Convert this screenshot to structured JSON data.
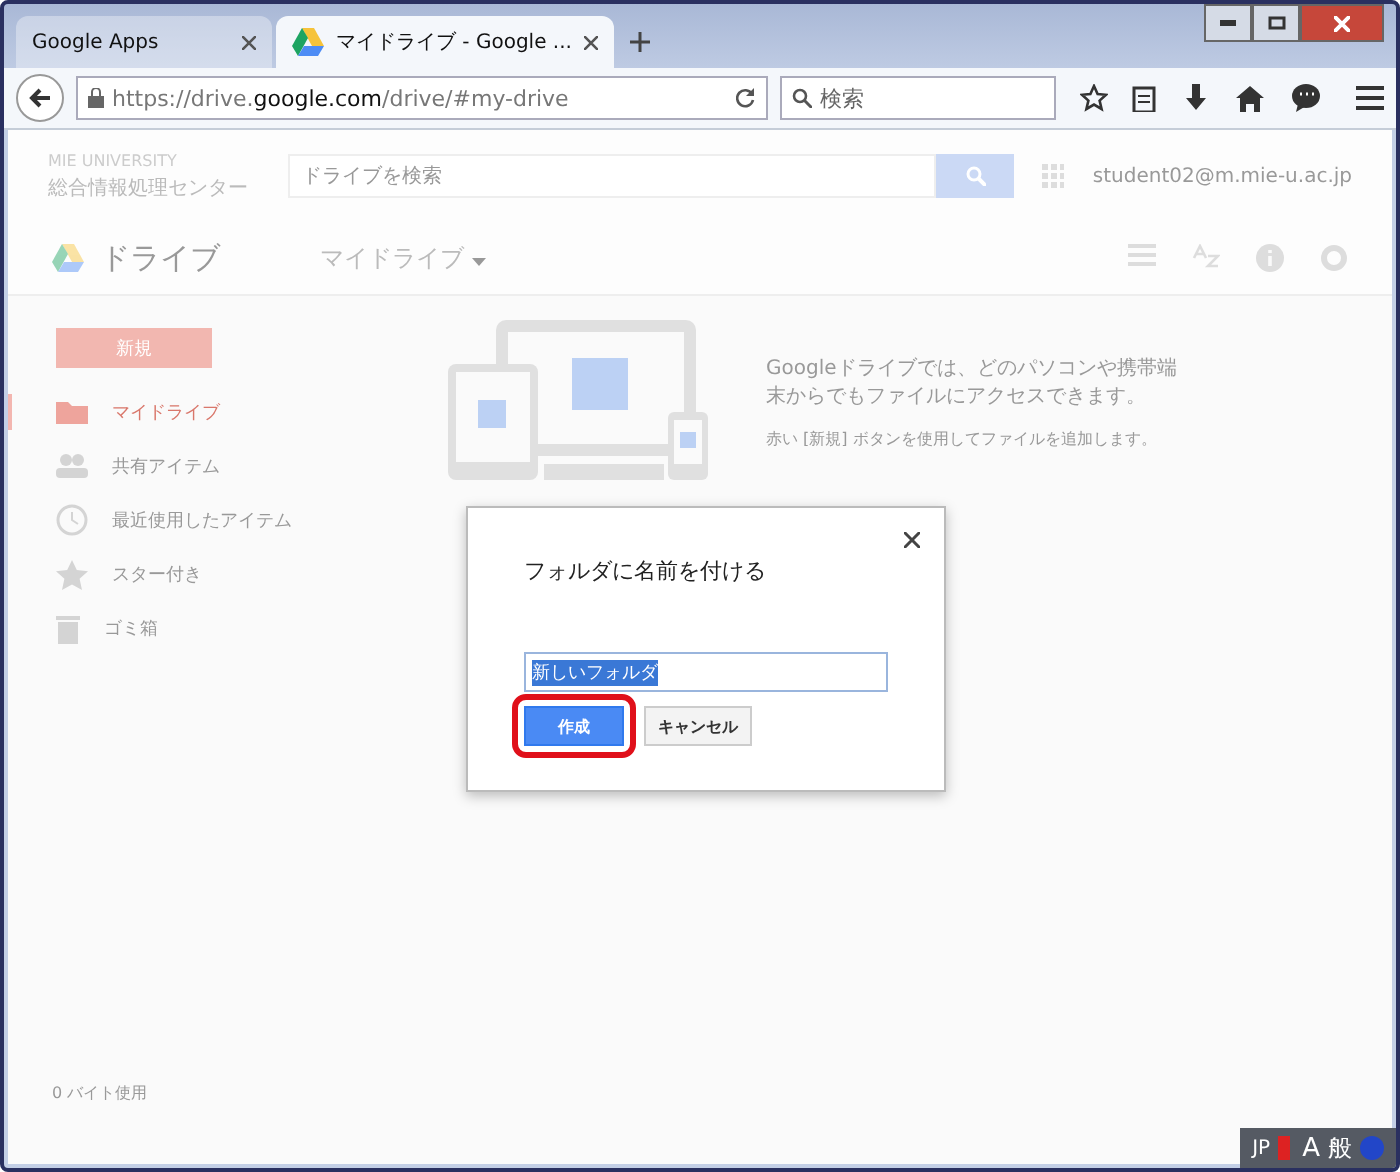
{
  "browser": {
    "tabs": [
      {
        "label": "Google Apps",
        "selected": false,
        "kind": "plain"
      },
      {
        "label": "マイドライブ - Google ...",
        "selected": true,
        "kind": "drive"
      }
    ],
    "url": {
      "host_before": "https://drive.",
      "host_bold": "google.com",
      "path": "/drive/#my-drive"
    },
    "search": {
      "placeholder": "検索"
    }
  },
  "drive": {
    "logo": {
      "university": "MIE UNIVERSITY",
      "center": "総合情報処理センター"
    },
    "search": {
      "placeholder": "ドライブを検索"
    },
    "account": "student02@m.mie-u.ac.jp",
    "product": "ドライブ",
    "location": "マイドライブ",
    "new_button": "新規",
    "sidebar": [
      {
        "label": "マイドライブ",
        "kind": "mydrive",
        "selected": true
      },
      {
        "label": "共有アイテム",
        "kind": "shared",
        "selected": false
      },
      {
        "label": "最近使用したアイテム",
        "kind": "recent",
        "selected": false
      },
      {
        "label": "スター付き",
        "kind": "starred",
        "selected": false
      },
      {
        "label": "ゴミ箱",
        "kind": "trash",
        "selected": false
      }
    ],
    "info": [
      "Googleドライブでは、どのパソコンや携帯端末からでもファイルにアクセスできます。",
      "赤い [新規] ボタンを使用してファイルを追加します。"
    ],
    "storage": "0 バイト使用"
  },
  "dialog": {
    "title": "フォルダに名前を付ける",
    "value": "新しいフォルダ",
    "value_selected": true,
    "buttons": [
      {
        "label": "作成",
        "kind": "primary",
        "highlighted": true
      },
      {
        "label": "キャンセル",
        "kind": "secondary",
        "highlighted": false
      }
    ]
  },
  "language_bar": {
    "language": "JP",
    "mode": "A",
    "kana": "般"
  }
}
